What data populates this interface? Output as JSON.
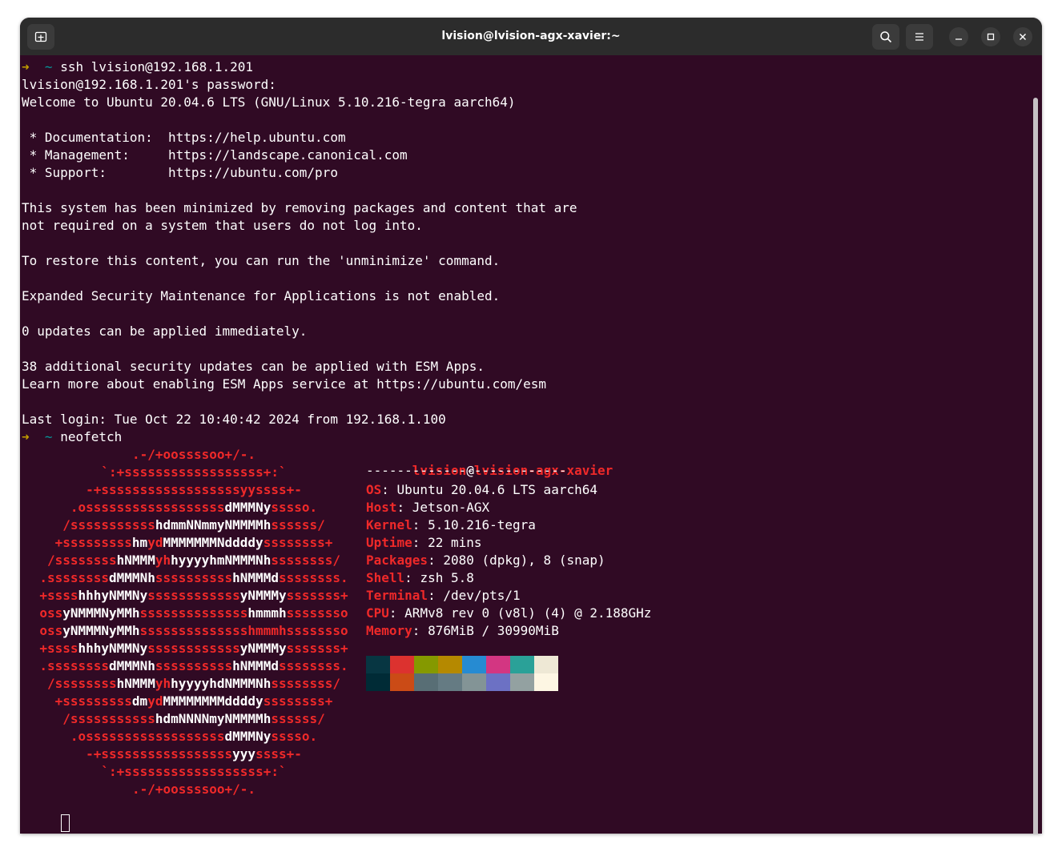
{
  "window": {
    "title": "lvision@lvision-agx-xavier:~"
  },
  "prompt": {
    "arrow": "➜",
    "cwd": "~"
  },
  "output_lines": [
    {
      "type": "cmd",
      "text": "ssh lvision@192.168.1.201"
    },
    {
      "type": "text",
      "text": "lvision@192.168.1.201's password:"
    },
    {
      "type": "text",
      "text": "Welcome to Ubuntu 20.04.6 LTS (GNU/Linux 5.10.216-tegra aarch64)"
    },
    {
      "type": "text",
      "text": ""
    },
    {
      "type": "text",
      "text": " * Documentation:  https://help.ubuntu.com"
    },
    {
      "type": "text",
      "text": " * Management:     https://landscape.canonical.com"
    },
    {
      "type": "text",
      "text": " * Support:        https://ubuntu.com/pro"
    },
    {
      "type": "text",
      "text": ""
    },
    {
      "type": "text",
      "text": "This system has been minimized by removing packages and content that are"
    },
    {
      "type": "text",
      "text": "not required on a system that users do not log into."
    },
    {
      "type": "text",
      "text": ""
    },
    {
      "type": "text",
      "text": "To restore this content, you can run the 'unminimize' command."
    },
    {
      "type": "text",
      "text": ""
    },
    {
      "type": "text",
      "text": "Expanded Security Maintenance for Applications is not enabled."
    },
    {
      "type": "text",
      "text": ""
    },
    {
      "type": "text",
      "text": "0 updates can be applied immediately."
    },
    {
      "type": "text",
      "text": ""
    },
    {
      "type": "text",
      "text": "38 additional security updates can be applied with ESM Apps."
    },
    {
      "type": "text",
      "text": "Learn more about enabling ESM Apps service at https://ubuntu.com/esm"
    },
    {
      "type": "text",
      "text": ""
    },
    {
      "type": "text",
      "text": "Last login: Tue Oct 22 10:40:42 2024 from 192.168.1.100"
    },
    {
      "type": "cmd",
      "text": "neofetch"
    }
  ],
  "neofetch": {
    "logo": [
      [
        {
          "t": ".-/+oossssoo+/-.",
          "w": false
        }
      ],
      [
        {
          "t": "`:+ssssssssssssssssss+:`",
          "w": false
        }
      ],
      [
        {
          "t": "-+ssssssssssssssssssyyssss+-",
          "w": false
        }
      ],
      [
        {
          "t": ".ossssssssssssssssss",
          "w": false
        },
        {
          "t": "dMMMNy",
          "w": true
        },
        {
          "t": "sssso.",
          "w": false
        }
      ],
      [
        {
          "t": "/sssssssssss",
          "w": false
        },
        {
          "t": "hdmmNNmmyNMMMMh",
          "w": true
        },
        {
          "t": "ssssss/",
          "w": false
        }
      ],
      [
        {
          "t": "+sssssssss",
          "w": false
        },
        {
          "t": "hm",
          "w": true
        },
        {
          "t": "yd",
          "w": false
        },
        {
          "t": "MMMMMMMNddddy",
          "w": true
        },
        {
          "t": "ssssssss+",
          "w": false
        }
      ],
      [
        {
          "t": "/ssssssss",
          "w": false
        },
        {
          "t": "hNMMM",
          "w": true
        },
        {
          "t": "yh",
          "w": false
        },
        {
          "t": "hyyyyhmNMMMNh",
          "w": true
        },
        {
          "t": "ssssssss/",
          "w": false
        }
      ],
      [
        {
          "t": ".ssssssss",
          "w": false
        },
        {
          "t": "dMMMNh",
          "w": true
        },
        {
          "t": "ssssssssss",
          "w": false
        },
        {
          "t": "hNMMMd",
          "w": true
        },
        {
          "t": "ssssssss.",
          "w": false
        }
      ],
      [
        {
          "t": "+ssss",
          "w": false
        },
        {
          "t": "hhhyNMMNy",
          "w": true
        },
        {
          "t": "ssssssssssss",
          "w": false
        },
        {
          "t": "yNMMMy",
          "w": true
        },
        {
          "t": "sssssss+",
          "w": false
        }
      ],
      [
        {
          "t": "oss",
          "w": false
        },
        {
          "t": "yNMMMNyMMh",
          "w": true
        },
        {
          "t": "ssssssssssssss",
          "w": false
        },
        {
          "t": "hmmmh",
          "w": true
        },
        {
          "t": "ssssssso",
          "w": false
        }
      ],
      [
        {
          "t": "oss",
          "w": false
        },
        {
          "t": "yNMMMNyMMh",
          "w": true
        },
        {
          "t": "sssssssssssssshmmmhssssssso",
          "w": false
        }
      ],
      [
        {
          "t": "+ssss",
          "w": false
        },
        {
          "t": "hhhyNMMNy",
          "w": true
        },
        {
          "t": "ssssssssssss",
          "w": false
        },
        {
          "t": "yNMMMy",
          "w": true
        },
        {
          "t": "sssssss+",
          "w": false
        }
      ],
      [
        {
          "t": ".ssssssss",
          "w": false
        },
        {
          "t": "dMMMNh",
          "w": true
        },
        {
          "t": "ssssssssss",
          "w": false
        },
        {
          "t": "hNMMMd",
          "w": true
        },
        {
          "t": "ssssssss.",
          "w": false
        }
      ],
      [
        {
          "t": "/ssssssss",
          "w": false
        },
        {
          "t": "hNMMM",
          "w": true
        },
        {
          "t": "yh",
          "w": false
        },
        {
          "t": "hyyyyhdNMMMNh",
          "w": true
        },
        {
          "t": "ssssssss/",
          "w": false
        }
      ],
      [
        {
          "t": "+sssssssss",
          "w": false
        },
        {
          "t": "dm",
          "w": true
        },
        {
          "t": "yd",
          "w": false
        },
        {
          "t": "MMMMMMMMddddy",
          "w": true
        },
        {
          "t": "ssssssss+",
          "w": false
        }
      ],
      [
        {
          "t": "/sssssssssss",
          "w": false
        },
        {
          "t": "hdmNNNNmyNMMMMh",
          "w": true
        },
        {
          "t": "ssssss/",
          "w": false
        }
      ],
      [
        {
          "t": ".ossssssssssssssssss",
          "w": false
        },
        {
          "t": "dMMMNy",
          "w": true
        },
        {
          "t": "sssso.",
          "w": false
        }
      ],
      [
        {
          "t": "-+sssssssssssssssss",
          "w": false
        },
        {
          "t": "yyy",
          "w": true
        },
        {
          "t": "ssss+-",
          "w": false
        }
      ],
      [
        {
          "t": "`:+ssssssssssssssssss+:`",
          "w": false
        }
      ],
      [
        {
          "t": ".-/+oossssoo+/-.",
          "w": false
        }
      ]
    ],
    "user": "lvision",
    "host": "lvision-agx-xavier",
    "separator": "--------------------------",
    "info": [
      {
        "key": "OS",
        "value": "Ubuntu 20.04.6 LTS aarch64"
      },
      {
        "key": "Host",
        "value": "Jetson-AGX"
      },
      {
        "key": "Kernel",
        "value": "5.10.216-tegra"
      },
      {
        "key": "Uptime",
        "value": "22 mins"
      },
      {
        "key": "Packages",
        "value": "2080 (dpkg), 8 (snap)"
      },
      {
        "key": "Shell",
        "value": "zsh 5.8"
      },
      {
        "key": "Terminal",
        "value": "/dev/pts/1"
      },
      {
        "key": "CPU",
        "value": "ARMv8 rev 0 (v8l) (4) @ 2.188GHz"
      },
      {
        "key": "Memory",
        "value": "876MiB / 30990MiB"
      }
    ],
    "palette_top": [
      "#073642",
      "#dc322f",
      "#859900",
      "#b58900",
      "#268bd2",
      "#d33682",
      "#2aa198",
      "#eee8d5"
    ],
    "palette_bottom": [
      "#002b36",
      "#cb4b16",
      "#586e75",
      "#657b83",
      "#839496",
      "#6c71c4",
      "#93a1a1",
      "#fdf6e3"
    ]
  },
  "icons": {
    "new_tab": "new-tab-icon",
    "search": "search-icon",
    "menu": "hamburger-menu-icon",
    "minimize": "minimize-icon",
    "maximize": "maximize-icon",
    "close": "close-icon"
  },
  "colors": {
    "terminal_bg": "#300a24",
    "titlebar_bg": "#2c2c2c",
    "prompt_arrow": "#c4a000",
    "prompt_dir": "#06989a",
    "neofetch_accent": "#ef2929"
  }
}
